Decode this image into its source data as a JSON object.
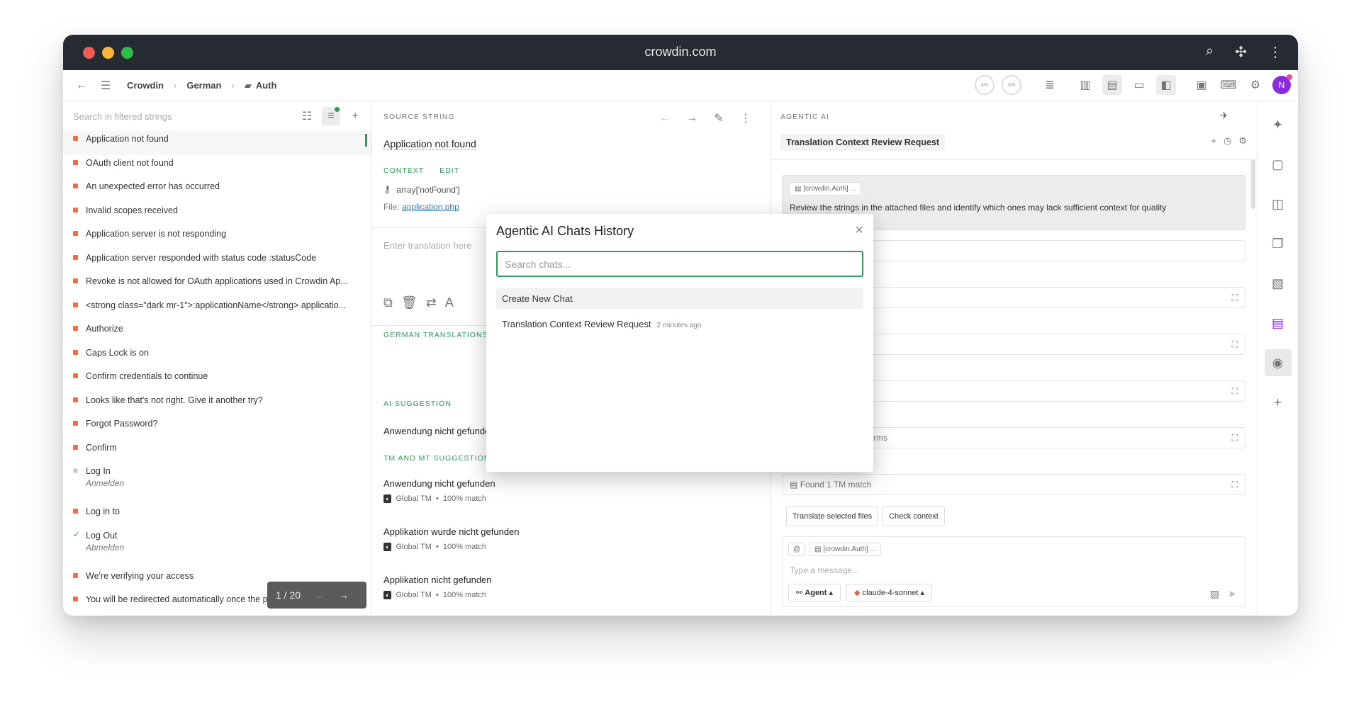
{
  "browser": {
    "url": "crowdin.com",
    "traffic_colors": [
      "#f15b55",
      "#f9b63a",
      "#2fbf48"
    ]
  },
  "toolbar": {
    "breadcrumb": [
      "Crowdin",
      "German",
      "Auth"
    ],
    "progress_translated": "4%",
    "progress_approved": "0%",
    "avatar_initial": "N"
  },
  "strings_panel": {
    "search_placeholder": "Search in filtered strings",
    "items": [
      {
        "text": "Application not found",
        "status": "untranslated",
        "sub": ""
      },
      {
        "text": "OAuth client not found",
        "status": "untranslated",
        "sub": ""
      },
      {
        "text": "An unexpected error has occurred",
        "status": "untranslated",
        "sub": ""
      },
      {
        "text": "Invalid scopes received",
        "status": "untranslated",
        "sub": ""
      },
      {
        "text": "Application server is not responding",
        "status": "untranslated",
        "sub": ""
      },
      {
        "text": "Application server responded with status code :statusCode",
        "status": "untranslated",
        "sub": ""
      },
      {
        "text": "Revoke is not allowed for OAuth applications used in Crowdin Ap...",
        "status": "untranslated",
        "sub": ""
      },
      {
        "text": "<strong class=\"dark mr-1\">:applicationName</strong> applicatio...",
        "status": "untranslated",
        "sub": ""
      },
      {
        "text": "Authorize",
        "status": "untranslated",
        "sub": ""
      },
      {
        "text": "Caps Lock is on",
        "status": "untranslated",
        "sub": ""
      },
      {
        "text": "Confirm credentials to continue",
        "status": "untranslated",
        "sub": ""
      },
      {
        "text": "Looks like that's not right. Give it another try?",
        "status": "untranslated",
        "sub": ""
      },
      {
        "text": "Forgot Password?",
        "status": "untranslated",
        "sub": ""
      },
      {
        "text": "Confirm",
        "status": "untranslated",
        "sub": ""
      },
      {
        "text": "Log In",
        "status": "translated",
        "sub": "Anmelden"
      },
      {
        "text": "Log in to",
        "status": "untranslated",
        "sub": ""
      },
      {
        "text": "Log Out",
        "status": "approved",
        "sub": "Abmelden"
      },
      {
        "text": "We're verifying your access",
        "status": "untranslated",
        "sub": ""
      },
      {
        "text": "You will be redirected automatically once the process is complete.",
        "status": "untranslated",
        "sub": ""
      }
    ],
    "pager": "1 / 20"
  },
  "editor": {
    "source_label": "SOURCE STRING",
    "source_text": "Application not found",
    "context_label": "CONTEXT",
    "edit_label": "EDIT",
    "context_key": "array['notFound']",
    "file_prefix": "File:",
    "file_name": "application.php",
    "translation_placeholder": "Enter translation here",
    "german_translations_label": "GERMAN TRANSLATIONS",
    "ai_suggestion_label": "AI SUGGESTION",
    "ai_suggestion_text": "Anwendung nicht gefunden",
    "tm_label": "TM AND MT SUGGESTIONS",
    "tm_items": [
      {
        "text": "Anwendung nicht gefunden",
        "source": "Global TM",
        "match": "100% match"
      },
      {
        "text": "Applikation wurde nicht gefunden",
        "source": "Global TM",
        "match": "100% match"
      },
      {
        "text": "Applikation nicht gefunden",
        "source": "Global TM",
        "match": "100% match"
      }
    ]
  },
  "agentic": {
    "label": "AGENTIC AI",
    "chat_title": "Translation Context Review Request",
    "message_chip": "[crowdin.Auth] ...",
    "message_text": "Review the strings in the attached files and identify which ones may lack sufficient context for quality",
    "partial_text": "rms",
    "tm_found": "Found 1 TM match",
    "action_translate": "Translate selected files",
    "action_check": "Check context",
    "input_chip": "[crowdin.Auth] ...",
    "input_placeholder": "Type a message...",
    "mode": "Agent",
    "model": "claude-4-sonnet"
  },
  "modal": {
    "title": "Agentic AI Chats History",
    "search_placeholder": "Search chats...",
    "create_label": "Create New Chat",
    "history": [
      {
        "title": "Translation Context Review Request",
        "ago": "2 minutes ago"
      }
    ]
  }
}
